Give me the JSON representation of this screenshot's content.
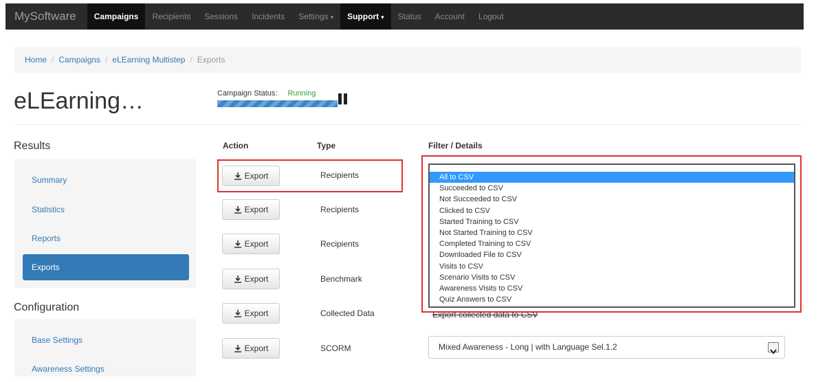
{
  "navbar": {
    "brand": "MySoftware",
    "items": [
      {
        "label": "Campaigns",
        "active": true
      },
      {
        "label": "Recipients"
      },
      {
        "label": "Sessions"
      },
      {
        "label": "Incidents"
      },
      {
        "label": "Settings",
        "dropdown": true
      },
      {
        "label": "Support",
        "dropdown": true,
        "active": true
      },
      {
        "label": "Status"
      },
      {
        "label": "Account"
      },
      {
        "label": "Logout"
      }
    ]
  },
  "breadcrumb": {
    "home": "Home",
    "campaigns": "Campaigns",
    "campaign": "eLEarning Multistep",
    "current": "Exports",
    "separator": "/"
  },
  "page": {
    "title": "eLEarning…",
    "status_label": "Campaign Status:",
    "status_value": "Running",
    "progress_fraction": 1.0
  },
  "sidebar": {
    "results_title": "Results",
    "results_items": [
      "Summary",
      "Statistics",
      "Reports",
      "Exports"
    ],
    "active_item": "Exports",
    "config_title": "Configuration",
    "config_items": [
      "Base Settings",
      "Awareness Settings"
    ]
  },
  "table": {
    "headers": {
      "action": "Action",
      "type": "Type",
      "filter": "Filter / Details"
    },
    "export_label": "Export",
    "rows": [
      {
        "type": "Recipients"
      },
      {
        "type": "Recipients"
      },
      {
        "type": "Recipients"
      },
      {
        "type": "Benchmark"
      },
      {
        "type": "Collected Data",
        "filter": "Export collected data to CSV"
      },
      {
        "type": "SCORM",
        "filter": "Mixed Awareness - Long | with Language Sel.1.2"
      }
    ]
  },
  "listbox": {
    "options": [
      "All to CSV",
      "Succeeded to CSV",
      "Not Succeeded to CSV",
      "Clicked to CSV",
      "Started Training to CSV",
      "Not Started Training to CSV",
      "Completed Training to CSV",
      "Downloaded File to CSV",
      "Visits to CSV",
      "Scenario Visits to CSV",
      "Awareness Visits to CSV",
      "Quiz Answers to CSV"
    ],
    "selected": "All to CSV"
  },
  "colors": {
    "navbar_bg": "#2b2b2b",
    "link": "#337ab7",
    "running": "#3c9a3c",
    "highlight": "#e0312f",
    "selection": "#3399ff"
  }
}
